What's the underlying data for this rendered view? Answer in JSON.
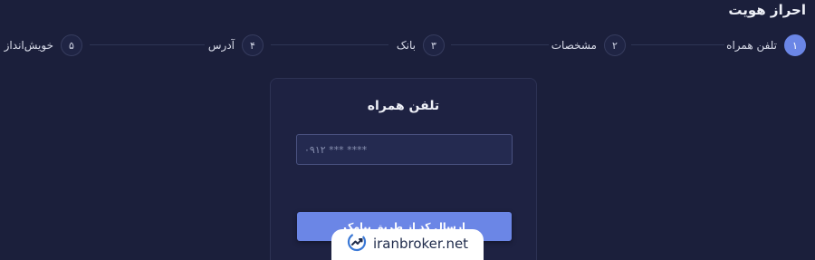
{
  "header": {
    "title": "احراز هویت"
  },
  "stepper": {
    "steps": [
      {
        "number": "۱",
        "label": "تلفن همراه",
        "active": true
      },
      {
        "number": "۲",
        "label": "مشخصات",
        "active": false
      },
      {
        "number": "۳",
        "label": "بانک",
        "active": false
      },
      {
        "number": "۴",
        "label": "آدرس",
        "active": false
      },
      {
        "number": "۵",
        "label": "خویش‌انداز",
        "active": false
      }
    ]
  },
  "card": {
    "title": "تلفن همراه",
    "phone_input": {
      "value": "",
      "placeholder": "۰۹۱۲ *** ****"
    },
    "send_button_label": "ارسال کد از طریق پیامک"
  },
  "watermark": {
    "text": "iranbroker.net",
    "icon": "chart-trend-logo-icon"
  },
  "colors": {
    "background": "#1b1f3b",
    "accent": "#6b86e6",
    "card": "#1e2242"
  }
}
